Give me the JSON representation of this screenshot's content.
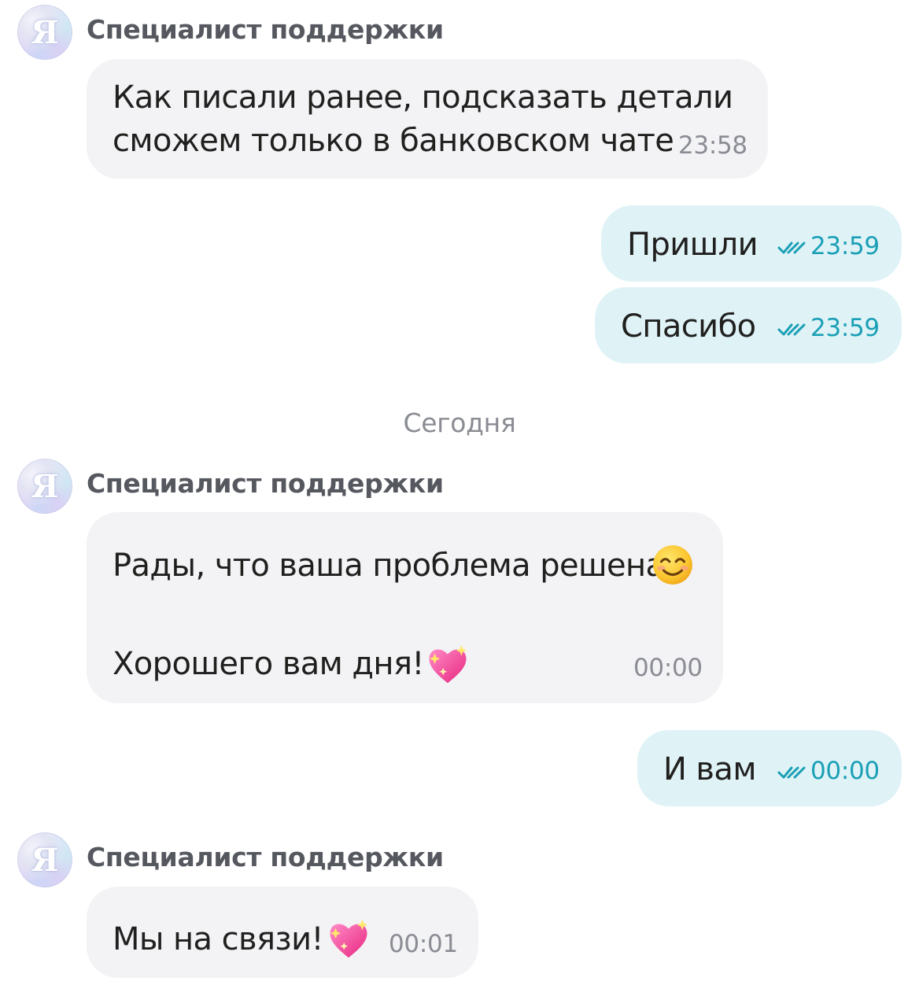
{
  "support_name": "Специалист поддержки",
  "avatar_letter": "Я",
  "date_separator": "Сегодня",
  "messages": [
    {
      "direction": "in",
      "lines": [
        "Как писали ранее, подсказать детали",
        "сможем только в банковском чате"
      ],
      "time": "23:58"
    },
    {
      "direction": "out",
      "text": "Пришли",
      "time": "23:59",
      "status_icon": "double-check-icon"
    },
    {
      "direction": "out",
      "text": "Спасибо",
      "time": "23:59",
      "status_icon": "double-check-icon"
    },
    {
      "direction": "in",
      "lines": [
        "Рады, что ваша проблема решена",
        "Хорошего вам дня!"
      ],
      "emojis": [
        "smiling-face-emoji",
        "sparkling-heart-emoji"
      ],
      "time": "00:00"
    },
    {
      "direction": "out",
      "text": "И вам",
      "time": "00:00",
      "status_icon": "double-check-icon"
    },
    {
      "direction": "in",
      "text": "Мы на связи!",
      "emojis": [
        "sparkling-heart-emoji"
      ],
      "time": "00:01"
    }
  ],
  "colors": {
    "incoming_bubble": "#f3f3f6",
    "outgoing_bubble": "#dff3f7",
    "outgoing_time": "#1a9fb5",
    "muted_text": "#8a8c93"
  }
}
